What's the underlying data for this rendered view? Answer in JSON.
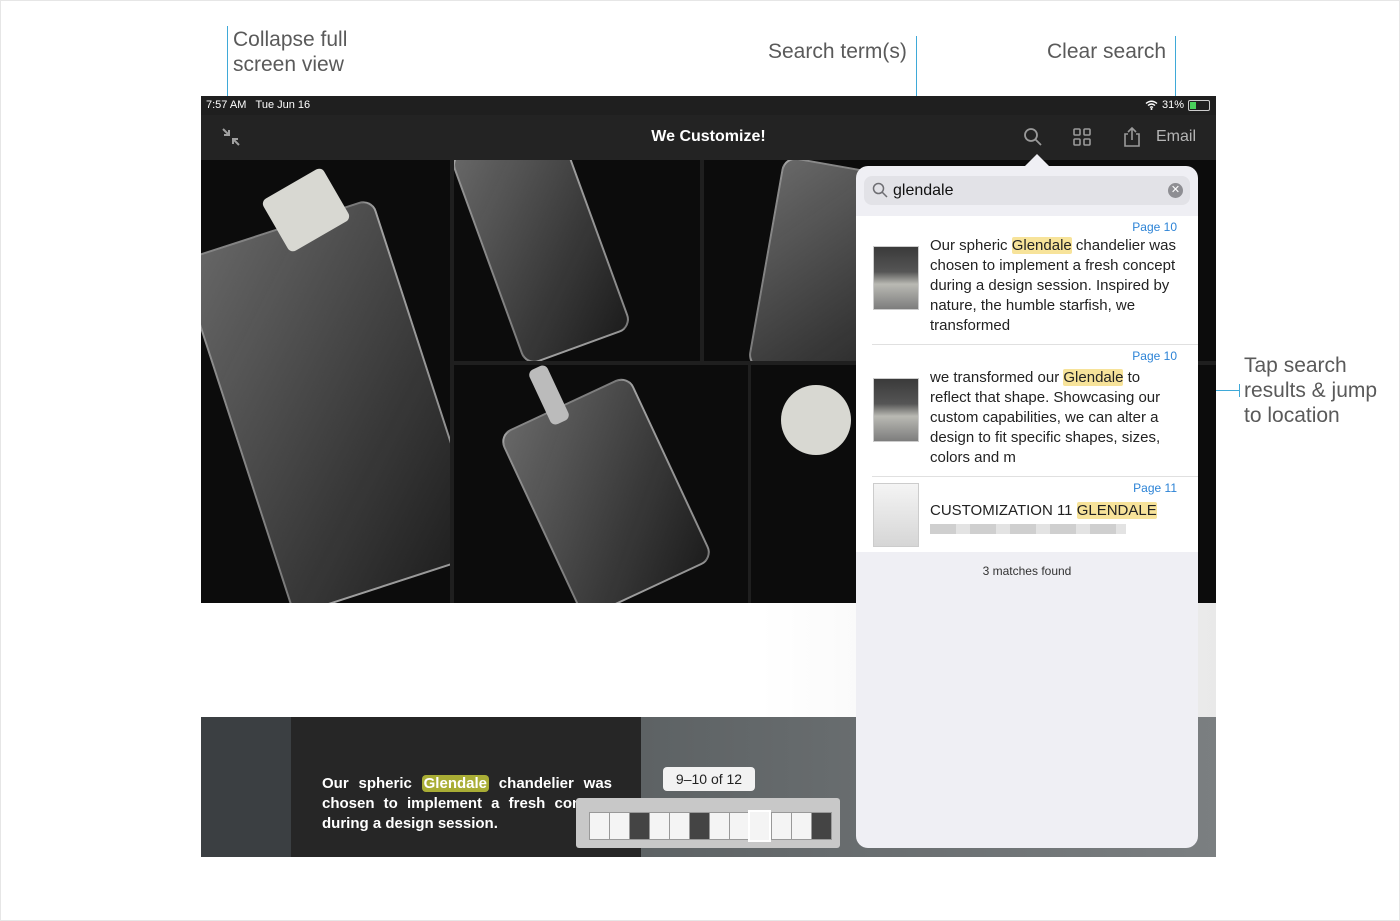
{
  "annotations": {
    "collapse": [
      "Collapse full",
      "screen view"
    ],
    "search_terms": "Search term(s)",
    "clear_search": "Clear search",
    "tap_results": [
      "Tap search",
      "results & jump",
      "to location"
    ],
    "line_color": "#3fa9d8"
  },
  "status_bar": {
    "time": "7:57 AM",
    "date": "Tue Jun 16",
    "battery": "31%"
  },
  "toolbar": {
    "collapse_icon": "collapse-fullscreen-icon",
    "title": "We Customize!",
    "search_icon": "search-icon",
    "grid_icon": "grid-icon",
    "share_icon": "share-icon",
    "email_label": "Email"
  },
  "document": {
    "caption_before": "Our spheric ",
    "caption_highlight": "Glendale",
    "caption_after": " chandelier was chosen to implement a fresh concept during a design session.",
    "page_indicator": "9–10 of 12",
    "highlight_color": "#a9ad35"
  },
  "search": {
    "query": "glendale",
    "results": [
      {
        "page": "Page 10",
        "before": "Our spheric ",
        "highlight": "Glendale",
        "after": " chandelier was chosen to implement a fresh concept during a design session. Inspired by nature, the humble starfish, we transformed"
      },
      {
        "page": "Page 10",
        "before": "we transformed our ",
        "highlight": "Glendale",
        "after": " to reflect that shape. Showcasing our custom capabilities, we can alter a design to fit specific shapes, sizes, colors and m"
      },
      {
        "page": "Page 11",
        "before": "CUSTOMIZATION 11 ",
        "highlight": "GLENDALE",
        "after": ""
      }
    ],
    "matches_text": "3 matches found",
    "highlight_color": "#f7e39a",
    "page_link_color": "#2c83d6"
  }
}
